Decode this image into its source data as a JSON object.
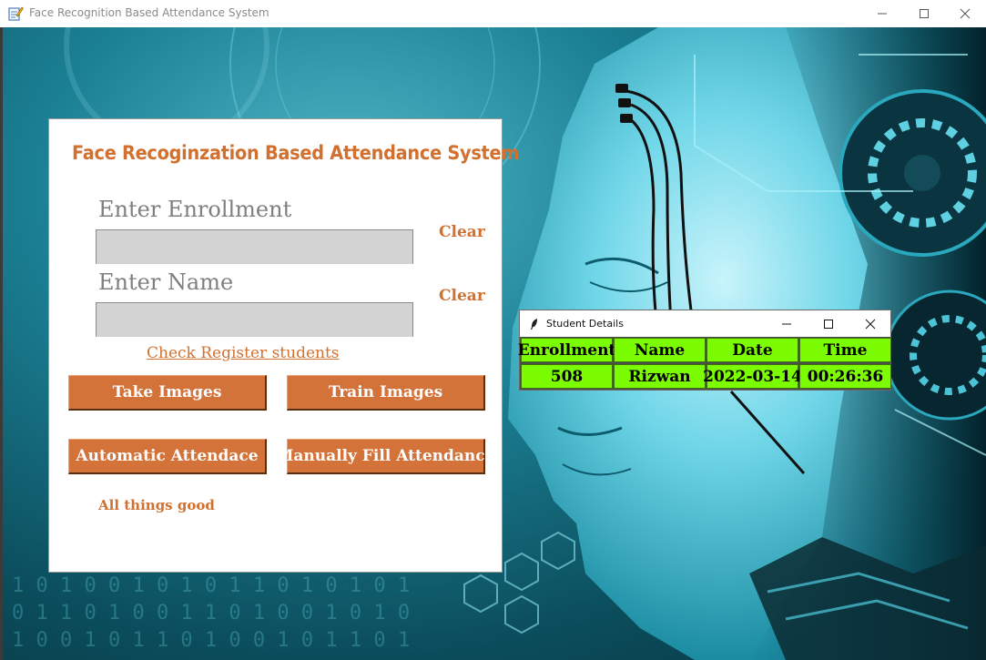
{
  "window": {
    "title": "Face Recognition Based Attendance System",
    "app_icon": "notepad-pencil-icon",
    "controls": [
      "minimize-icon",
      "maximize-icon",
      "close-icon"
    ]
  },
  "panel": {
    "heading": "Face Recoginzation Based Attendance System",
    "enrollment": {
      "label": "Enter Enrollment",
      "value": "",
      "clear_label": "Clear"
    },
    "name": {
      "label": "Enter Name",
      "value": "",
      "clear_label": "Clear"
    },
    "register_link": "Check Register students",
    "buttons": {
      "take_images": "Take Images",
      "train_images": "Train Images",
      "automatic_attendance": "Automatic Attendace",
      "manual_attendance": "Manually Fill Attendance"
    },
    "status": "All things good"
  },
  "student_details": {
    "title": "Student Details",
    "icon": "feather-icon",
    "headers": [
      "Enrollment",
      "Name",
      "Date",
      "Time"
    ],
    "rows": [
      [
        "508",
        "Rizwan",
        "2022-03-14",
        "00:26:36"
      ]
    ]
  },
  "colors": {
    "accent": "#d2712f",
    "button": "#d3733a",
    "table_cell": "#7cfc00",
    "field": "#d3d3d3"
  }
}
